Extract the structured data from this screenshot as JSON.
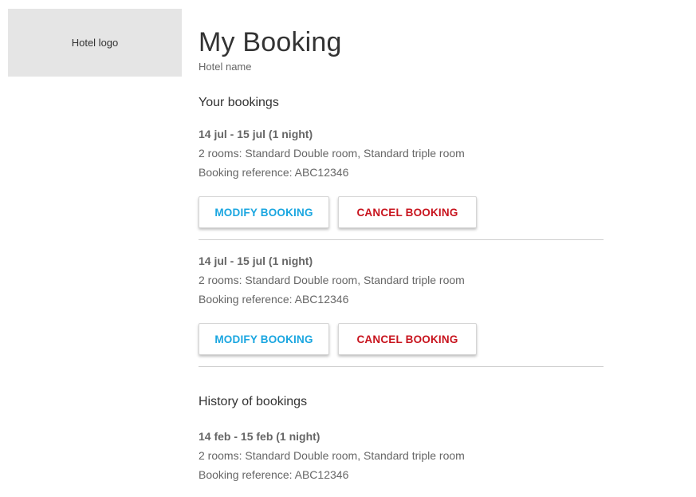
{
  "header": {
    "logo_text": "Hotel logo",
    "title": "My Booking",
    "hotel_name": "Hotel name"
  },
  "current": {
    "section_title": "Your bookings",
    "bookings": [
      {
        "dates": "14 jul - 15 jul (1 night)",
        "rooms": "2 rooms: Standard Double room, Standard triple room",
        "reference": "Booking reference: ABC12346",
        "modify_label": "MODIFY BOOKING",
        "cancel_label": "CANCEL BOOKING"
      },
      {
        "dates": "14 jul - 15 jul (1 night)",
        "rooms": "2 rooms: Standard Double room, Standard triple room",
        "reference": "Booking reference: ABC12346",
        "modify_label": "MODIFY BOOKING",
        "cancel_label": "CANCEL BOOKING"
      }
    ]
  },
  "history": {
    "section_title": "History of bookings",
    "bookings": [
      {
        "dates": "14 feb - 15 feb (1 night)",
        "rooms": "2 rooms: Standard Double room, Standard triple room",
        "reference": "Booking reference: ABC12346"
      }
    ]
  },
  "colors": {
    "modify_button_text": "#1aa6e0",
    "cancel_button_text": "#c8141e",
    "logo_placeholder_bg": "#e5e5e5"
  }
}
